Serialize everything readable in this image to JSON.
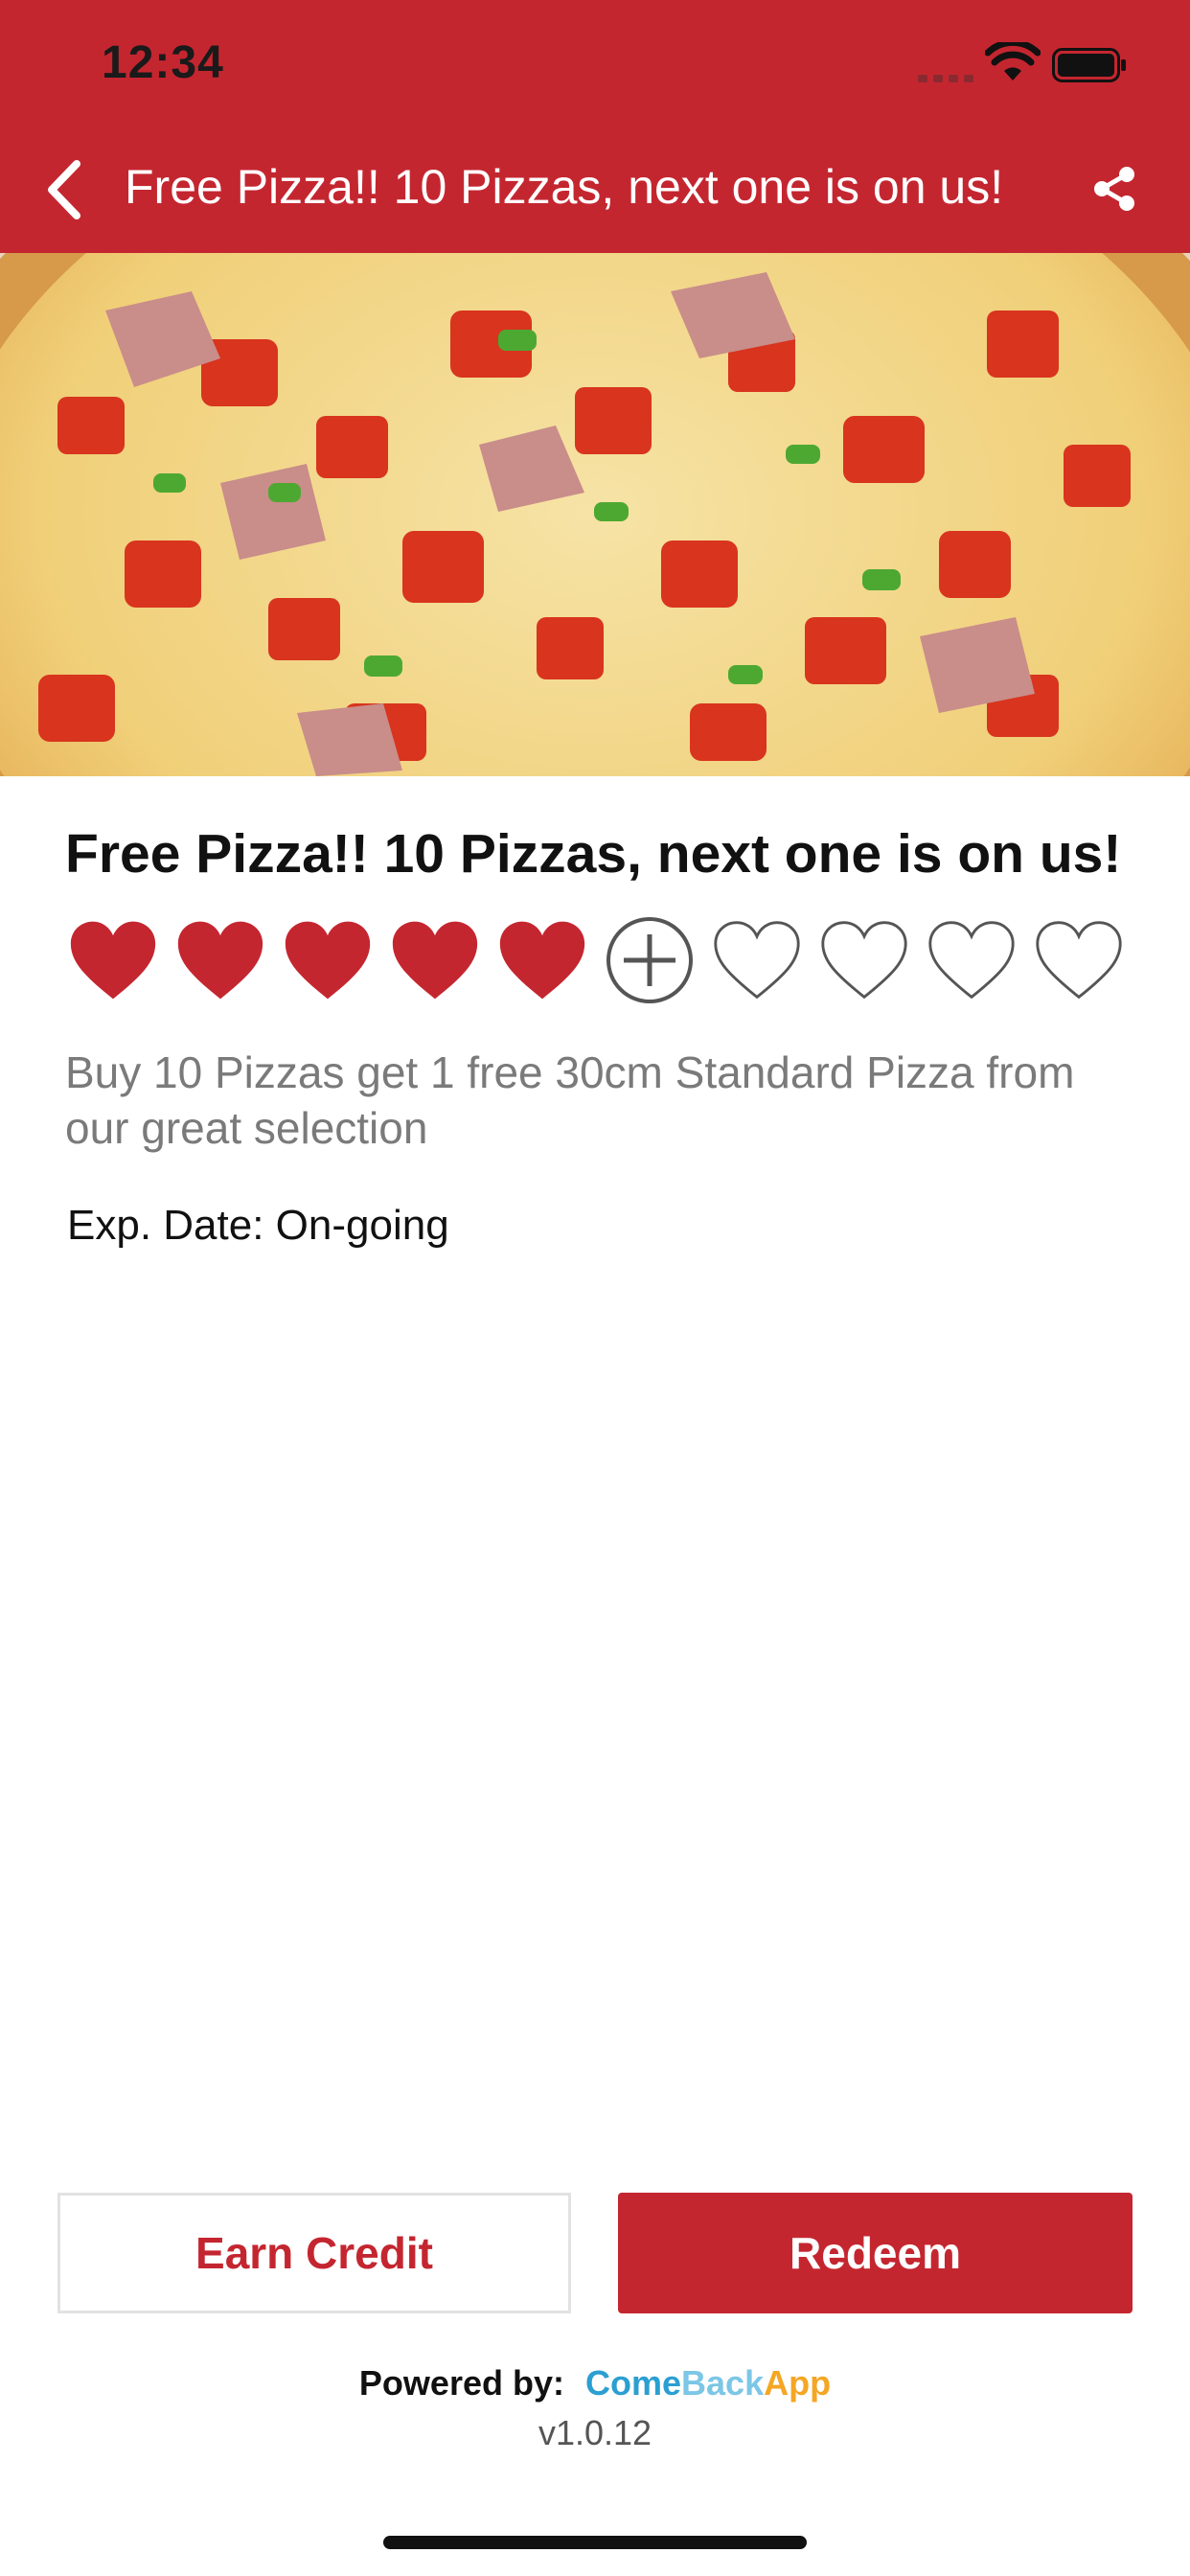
{
  "status_bar": {
    "time": "12:34"
  },
  "nav": {
    "title": "Free Pizza!! 10 Pizzas, next one is on us!"
  },
  "offer": {
    "title": "Free Pizza!! 10 Pizzas, next one is on us!",
    "stamps_total": 10,
    "stamps_filled": 5,
    "description": "Buy 10 Pizzas get 1 free 30cm Standard Pizza from our great selection",
    "exp_label": "Exp. Date:",
    "exp_value": "On-going"
  },
  "buttons": {
    "earn_label": "Earn Credit",
    "redeem_label": "Redeem"
  },
  "footer": {
    "powered_label": "Powered by:",
    "brand_part1": "Come",
    "brand_part2": "Back",
    "brand_part3": "App",
    "version": "v1.0.12"
  },
  "colors": {
    "brand_red": "#c42630",
    "brand_blue": "#2b9fd1",
    "brand_light_blue": "#7cc6e6",
    "brand_orange": "#f5a623",
    "icons": {
      "back": "chevron-left-icon",
      "share": "share-icon",
      "stamp_filled": "heart-filled-icon",
      "stamp_next": "plus-circle-icon",
      "stamp_empty": "heart-outline-icon"
    }
  }
}
